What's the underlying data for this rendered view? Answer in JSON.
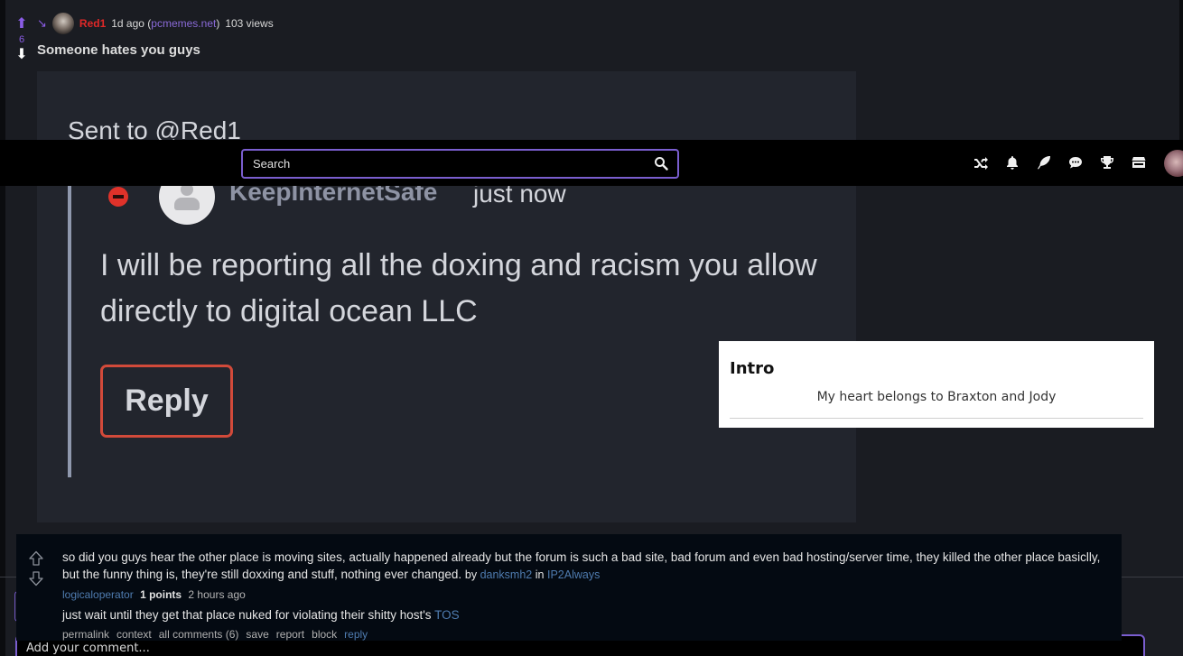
{
  "post": {
    "score": "6",
    "author": "Red1",
    "age": "1d ago",
    "domain_open": "(",
    "domain": "pcmemes.net",
    "domain_close": ")",
    "views": "103 views",
    "title": "Someone hates you guys"
  },
  "embed": {
    "sent_to": "Sent to @Red1",
    "username": "KeepInternetSafe",
    "time": "just now",
    "message": "I will be reporting all the doxing and racism you allow directly to digital ocean LLC",
    "reply_label": "Reply"
  },
  "navbar": {
    "search_placeholder": "Search",
    "icons": [
      "random-icon",
      "bell-icon",
      "feather-icon",
      "chat-icon",
      "trophy-icon",
      "store-icon"
    ]
  },
  "intro": {
    "title": "Intro",
    "text": "My heart belongs to Braxton and Jody"
  },
  "comment": {
    "text": "so did you guys hear the other place is moving sites, actually happened already but the forum is such a bad site, bad forum and even bad hosting/server time, they killed the other place basiclly, but the funny thing is, they're still doxxing and stuff, nothing ever changed.",
    "by_label": "by",
    "by_user": "danksmh2",
    "in_label": "in",
    "in_sub": "IP2Always",
    "reply_author": "logicaloperator",
    "reply_points": "1 points",
    "reply_age": "2 hours ago",
    "reply_text": "just wait until they get that place nuked for violating their shitty host's",
    "reply_link": "TOS",
    "actions": {
      "permalink": "permalink",
      "context": "context",
      "all_comments": "all comments (6)",
      "save": "save",
      "report": "report",
      "block": "block",
      "reply": "reply"
    }
  },
  "comment_input": {
    "placeholder": "Add your comment..."
  },
  "colors": {
    "accent": "#7a5ecf",
    "author": "#e02828",
    "link": "#4f7cb0"
  }
}
